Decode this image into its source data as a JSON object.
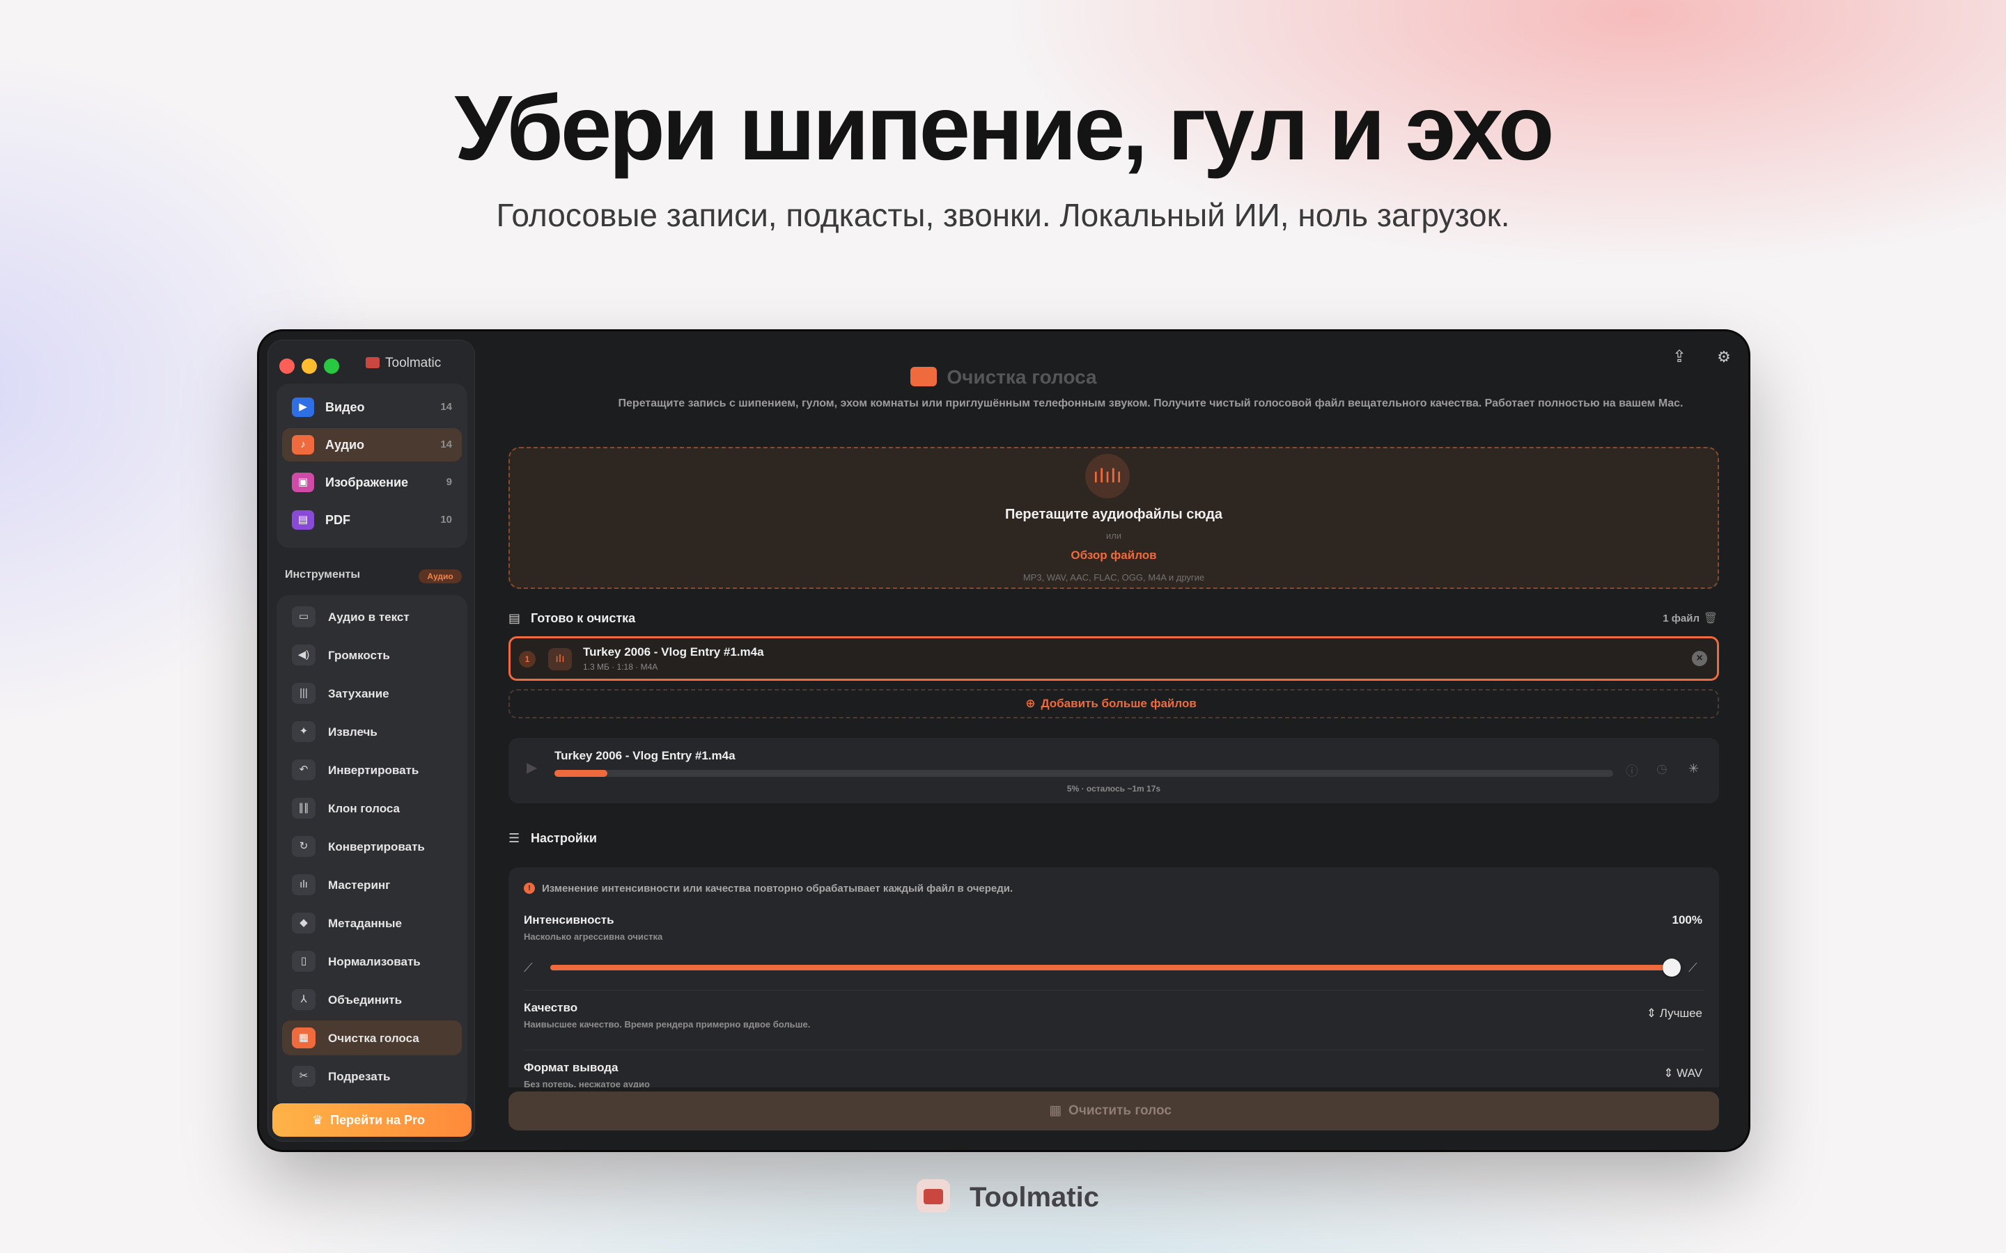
{
  "hero": {
    "title": "Убери шипение, гул и эхо",
    "subtitle": "Голосовые записи, подкасты, звонки. Локальный ИИ, ноль загрузок."
  },
  "app": {
    "title": "Toolmatic"
  },
  "categories": [
    {
      "label": "Видео",
      "count": "14",
      "color": "#2f6fe6",
      "icon": "video-icon"
    },
    {
      "label": "Аудио",
      "count": "14",
      "color": "#ef6b3d",
      "icon": "music-note-icon"
    },
    {
      "label": "Изображение",
      "count": "9",
      "color": "#d04aa8",
      "icon": "image-icon"
    },
    {
      "label": "PDF",
      "count": "10",
      "color": "#8a4ad8",
      "icon": "pdf-icon"
    }
  ],
  "tools_section": {
    "label": "Инструменты",
    "badge": "Аудио"
  },
  "tools": [
    {
      "label": "Аудио в текст",
      "icon": "speech-bubble-icon"
    },
    {
      "label": "Громкость",
      "icon": "speaker-icon"
    },
    {
      "label": "Затухание",
      "icon": "waveform-icon"
    },
    {
      "label": "Извлечь",
      "icon": "sparkle-icon"
    },
    {
      "label": "Инвертировать",
      "icon": "undo-icon"
    },
    {
      "label": "Клон голоса",
      "icon": "voice-wave-icon"
    },
    {
      "label": "Конвертировать",
      "icon": "refresh-icon"
    },
    {
      "label": "Мастеринг",
      "icon": "mastering-icon"
    },
    {
      "label": "Метаданные",
      "icon": "tag-icon"
    },
    {
      "label": "Нормализовать",
      "icon": "normalize-icon"
    },
    {
      "label": "Объединить",
      "icon": "merge-icon"
    },
    {
      "label": "Очистка голоса",
      "icon": "voice-clean-icon"
    },
    {
      "label": "Подрезать",
      "icon": "scissors-icon"
    }
  ],
  "pro_button": {
    "label": "Перейти на Pro"
  },
  "main": {
    "title": "Очистка голоса",
    "description": "Перетащите запись с шипением, гулом, эхом комнаты или приглушённым телефонным звуком. Получите чистый голосовой файл вещательного качества. Работает полностью на вашем Mac."
  },
  "dropzone": {
    "title": "Перетащите аудиофайлы сюда",
    "or": "или",
    "browse": "Обзор файлов",
    "formats": "MP3, WAV, AAC, FLAC, OGG, M4A и другие"
  },
  "queue": {
    "title": "Готово к очистка",
    "count": "1 файл",
    "file": {
      "index": "1",
      "name": "Turkey 2006 - Vlog Entry #1.m4a",
      "meta": "1.3 МБ · 1:18 · M4A"
    },
    "add_more": "Добавить больше файлов"
  },
  "progress": {
    "name": "Turkey 2006 - Vlog Entry #1.m4a",
    "percent": 5,
    "status": "5% · осталось ~1m 17s"
  },
  "settings": {
    "title": "Настройки",
    "notice": "Изменение интенсивности или качества повторно обрабатывает каждый файл в очереди.",
    "intensity": {
      "label": "Интенсивность",
      "desc": "Насколько агрессивна очистка",
      "value": "100%",
      "level": 1.0
    },
    "quality": {
      "label": "Качество",
      "desc": "Наивысшее качество. Время рендера примерно вдвое больше.",
      "value": "Лучшее"
    },
    "format": {
      "label": "Формат вывода",
      "desc": "Без потерь, несжатое аудио",
      "value": "WAV"
    }
  },
  "action_button": {
    "label": "Очистить голос"
  },
  "brand": {
    "name": "Toolmatic"
  },
  "colors": {
    "accent": "#ef6b3d",
    "window_bg": "#1c1d1f",
    "sidebar_bg": "#26272a"
  }
}
